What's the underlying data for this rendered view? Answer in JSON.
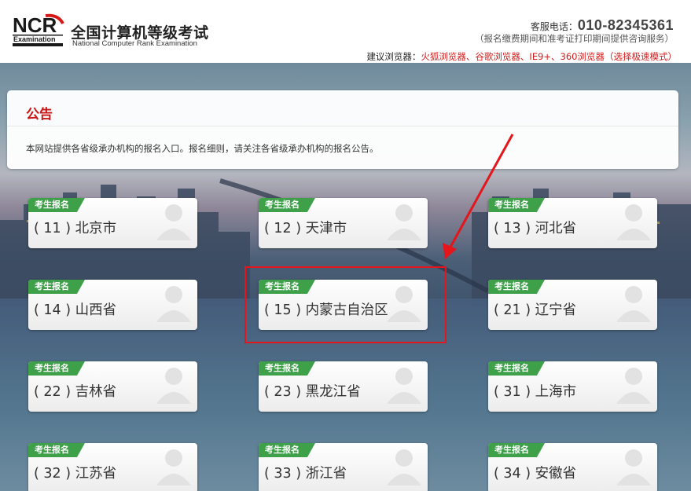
{
  "header": {
    "logo_mark": "NCR",
    "logo_small": "Examination",
    "title": "全国计算机等级考试",
    "subtitle": "National Computer Rank Examination",
    "hotline_label": "客服电话：",
    "hotline_number": "010-82345361",
    "hotline_note": "（报名缴费期间和准考证打印期间提供咨询服务）",
    "browser_label": "建议浏览器：",
    "browser_value": "火狐浏览器、谷歌浏览器、IE9+、360浏览器（选择极速模式）"
  },
  "notice": {
    "title": "公告",
    "text": "本网站提供各省级承办机构的报名入口。报名细则，请关注各省级承办机构的报名公告。"
  },
  "badge_label": "考生报名",
  "provinces": [
    {
      "label": "( 11 ) 北京市"
    },
    {
      "label": "( 12 ) 天津市"
    },
    {
      "label": "( 13 ) 河北省"
    },
    {
      "label": "( 14 ) 山西省"
    },
    {
      "label": "( 15 ) 内蒙古自治区"
    },
    {
      "label": "( 21 ) 辽宁省"
    },
    {
      "label": "( 22 ) 吉林省"
    },
    {
      "label": "( 23 ) 黑龙江省"
    },
    {
      "label": "( 31 ) 上海市"
    },
    {
      "label": "( 32 ) 江苏省"
    },
    {
      "label": "( 33 ) 浙江省"
    },
    {
      "label": "( 34 ) 安徽省"
    }
  ],
  "colors": {
    "accent_red": "#c91515",
    "badge_green": "#3fa04a",
    "annotation_red": "#e4151b"
  }
}
